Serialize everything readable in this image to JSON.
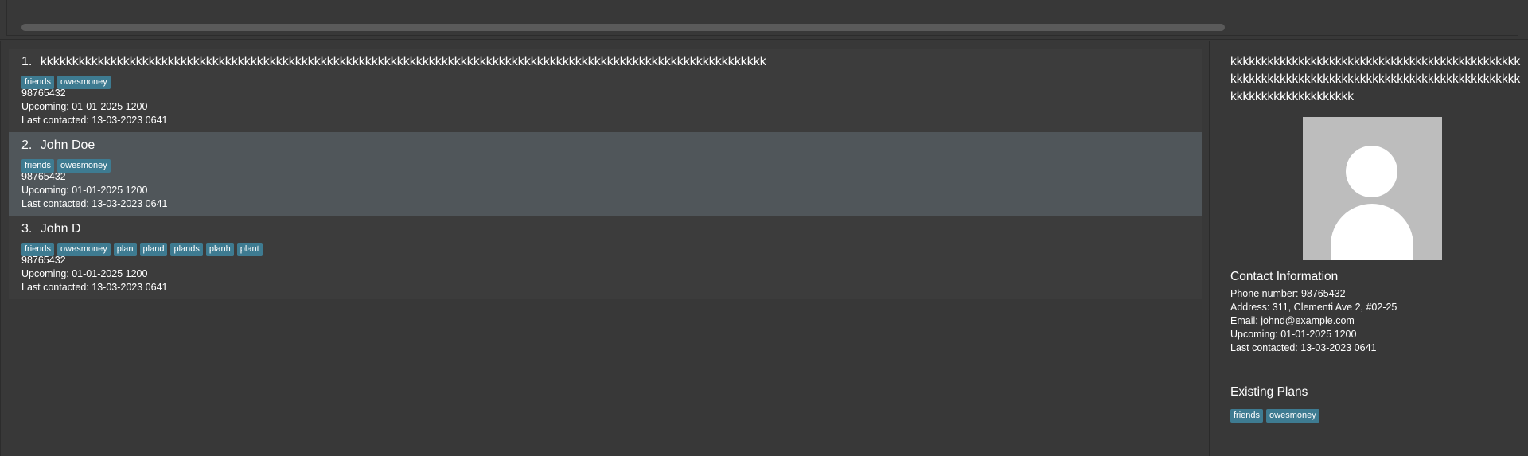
{
  "persons": [
    {
      "index": "1.",
      "name": "kkkkkkkkkkkkkkkkkkkkkkkkkkkkkkkkkkkkkkkkkkkkkkkkkkkkkkkkkkkkkkkkkkkkkkkkkkkkkkkkkkkkkkkkkkkkkkkkkkkkkkkkkkkkkkkkkk",
      "tags": [
        "friends",
        "owesmoney"
      ],
      "phone": "98765432",
      "upcoming": "Upcoming: 01-01-2025 1200",
      "last_contacted": "Last contacted: 13-03-2023 0641"
    },
    {
      "index": "2.",
      "name": "John Doe",
      "tags": [
        "friends",
        "owesmoney"
      ],
      "phone": "98765432",
      "upcoming": "Upcoming: 01-01-2025 1200",
      "last_contacted": "Last contacted: 13-03-2023 0641"
    },
    {
      "index": "3.",
      "name": "John D",
      "tags": [
        "friends",
        "owesmoney",
        "plan",
        "pland",
        "plands",
        "planh",
        "plant"
      ],
      "phone": "98765432",
      "upcoming": "Upcoming: 01-01-2025 1200",
      "last_contacted": "Last contacted: 13-03-2023 0641"
    }
  ],
  "selected_index": 2,
  "detail": {
    "name": "kkkkkkkkkkkkkkkkkkkkkkkkkkkkkkkkkkkkkkkkkkkkkkkkkkkkkkkkkkkkkkkkkkkkkkkkkkkkkkkkkkkkkkkkkkkkkkkkkkkkkkkkkkkkkkkkkk",
    "contact_title": "Contact Information",
    "phone": "Phone number: 98765432",
    "address": "Address: 311, Clementi Ave 2, #02-25",
    "email": "Email: johnd@example.com",
    "upcoming": "Upcoming: 01-01-2025 1200",
    "last_contacted": "Last contacted: 13-03-2023 0641",
    "plans_title": "Existing Plans",
    "plans": [
      "friends",
      "owesmoney"
    ]
  },
  "colors": {
    "background": "#383838",
    "card": "#3c3c3c",
    "card_selected": "#50565a",
    "tag": "#3e7b91",
    "avatar_bg": "#bdbdbd"
  },
  "icons": {
    "avatar": "person-silhouette-icon"
  }
}
